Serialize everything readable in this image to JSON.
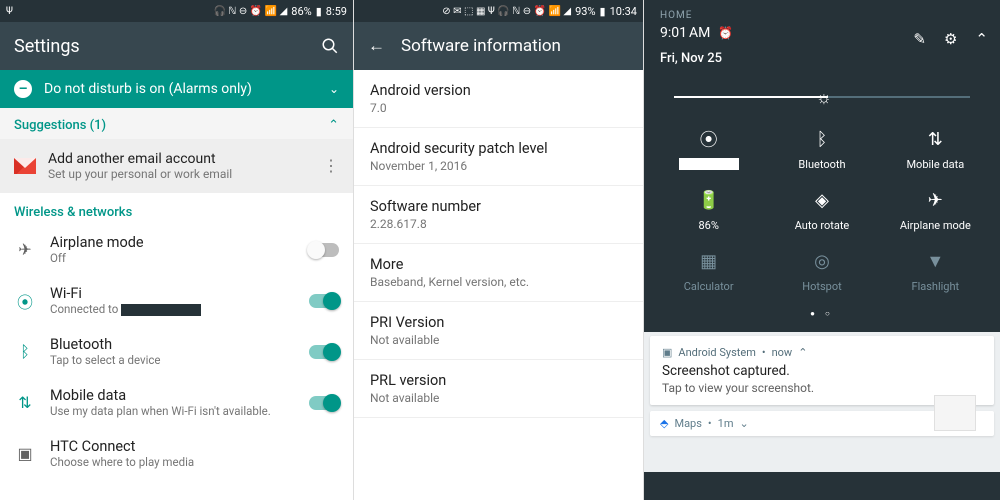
{
  "panel1": {
    "status": {
      "time": "8:59",
      "battery": "86%"
    },
    "title": "Settings",
    "dnd": "Do not disturb is on (Alarms only)",
    "suggestions_header": "Suggestions (1)",
    "suggestion": {
      "title": "Add another email account",
      "sub": "Set up your personal or work email"
    },
    "section": "Wireless & networks",
    "rows": {
      "airplane": {
        "title": "Airplane mode",
        "sub": "Off"
      },
      "wifi": {
        "title": "Wi-Fi",
        "sub_prefix": "Connected to "
      },
      "bluetooth": {
        "title": "Bluetooth",
        "sub": "Tap to select a device"
      },
      "mobiledata": {
        "title": "Mobile data",
        "sub": "Use my data plan when Wi-Fi isn't available."
      },
      "htc": {
        "title": "HTC Connect",
        "sub": "Choose where to play media"
      }
    }
  },
  "panel2": {
    "status": {
      "time": "10:34",
      "battery": "93%"
    },
    "title": "Software information",
    "items": [
      {
        "t": "Android version",
        "s": "7.0"
      },
      {
        "t": "Android security patch level",
        "s": "November 1, 2016"
      },
      {
        "t": "Software number",
        "s": "2.28.617.8"
      },
      {
        "t": "More",
        "s": "Baseband, Kernel version, etc."
      },
      {
        "t": "PRI Version",
        "s": "Not available"
      },
      {
        "t": "PRL version",
        "s": "Not available"
      }
    ]
  },
  "panel3": {
    "home": "HOME",
    "time": "9:01",
    "ampm": "AM",
    "date": "Fri, Nov 25",
    "tiles": {
      "wifi": "",
      "bluetooth": "Bluetooth",
      "mobiledata": "Mobile data",
      "battery": "86%",
      "rotate": "Auto rotate",
      "airplane": "Airplane mode",
      "calc": "Calculator",
      "hotspot": "Hotspot",
      "flashlight": "Flashlight"
    },
    "notif": {
      "app": "Android System",
      "when": "now",
      "title": "Screenshot captured.",
      "sub": "Tap to view your screenshot."
    },
    "maps": {
      "app": "Maps",
      "when": "1m"
    }
  }
}
